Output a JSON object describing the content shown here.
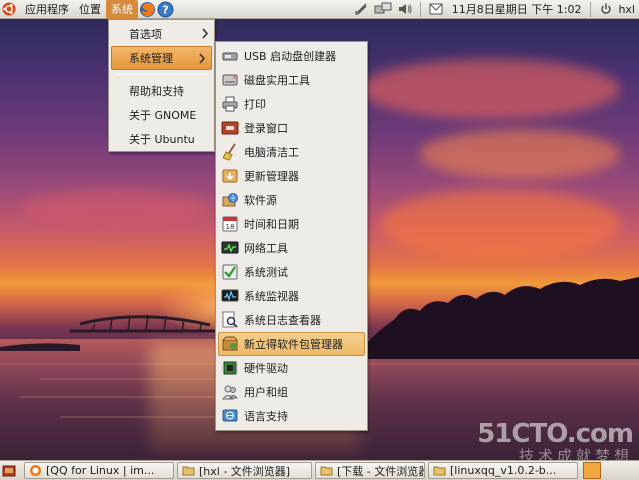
{
  "top_panel": {
    "applications_label": "应用程序",
    "places_label": "位置",
    "system_label": "系统",
    "clock": "11月8日星期日 下午 1:02",
    "user": "hxl"
  },
  "system_menu": {
    "items": [
      {
        "label": "首选项"
      },
      {
        "label": "系统管理"
      },
      {
        "label": "帮助和支持"
      },
      {
        "label": "关于 GNOME"
      },
      {
        "label": "关于 Ubuntu"
      }
    ]
  },
  "admin_menu": {
    "items": [
      {
        "label": "USB 启动盘创建器",
        "icon": "usb-drive-icon"
      },
      {
        "label": "磁盘实用工具",
        "icon": "disk-icon"
      },
      {
        "label": "打印",
        "icon": "printer-icon"
      },
      {
        "label": "登录窗口",
        "icon": "login-window-icon"
      },
      {
        "label": "电脑清洁工",
        "icon": "broom-icon"
      },
      {
        "label": "更新管理器",
        "icon": "update-manager-icon"
      },
      {
        "label": "软件源",
        "icon": "software-sources-icon"
      },
      {
        "label": "时间和日期",
        "icon": "calendar-icon"
      },
      {
        "label": "网络工具",
        "icon": "network-tools-icon"
      },
      {
        "label": "系统测试",
        "icon": "system-test-icon"
      },
      {
        "label": "系统监视器",
        "icon": "system-monitor-icon"
      },
      {
        "label": "系统日志查看器",
        "icon": "log-viewer-icon"
      },
      {
        "label": "新立得软件包管理器",
        "icon": "synaptic-icon"
      },
      {
        "label": "硬件驱动",
        "icon": "hardware-drivers-icon"
      },
      {
        "label": "用户和组",
        "icon": "users-icon"
      },
      {
        "label": "语言支持",
        "icon": "language-icon"
      }
    ]
  },
  "taskbar": {
    "tasks": [
      {
        "label": "[QQ for Linux | im..."
      },
      {
        "label": "[hxl - 文件浏览器]"
      },
      {
        "label": "[下载 - 文件浏览器]"
      },
      {
        "label": "[linuxqq_v1.0.2-b..."
      }
    ]
  },
  "watermark": {
    "main": "51CTO.com",
    "sub": "技术成就梦想"
  },
  "colors": {
    "menu_highlight": "#e6963a",
    "selected_item": "#eeba66",
    "panel": "#dcd8d0"
  }
}
